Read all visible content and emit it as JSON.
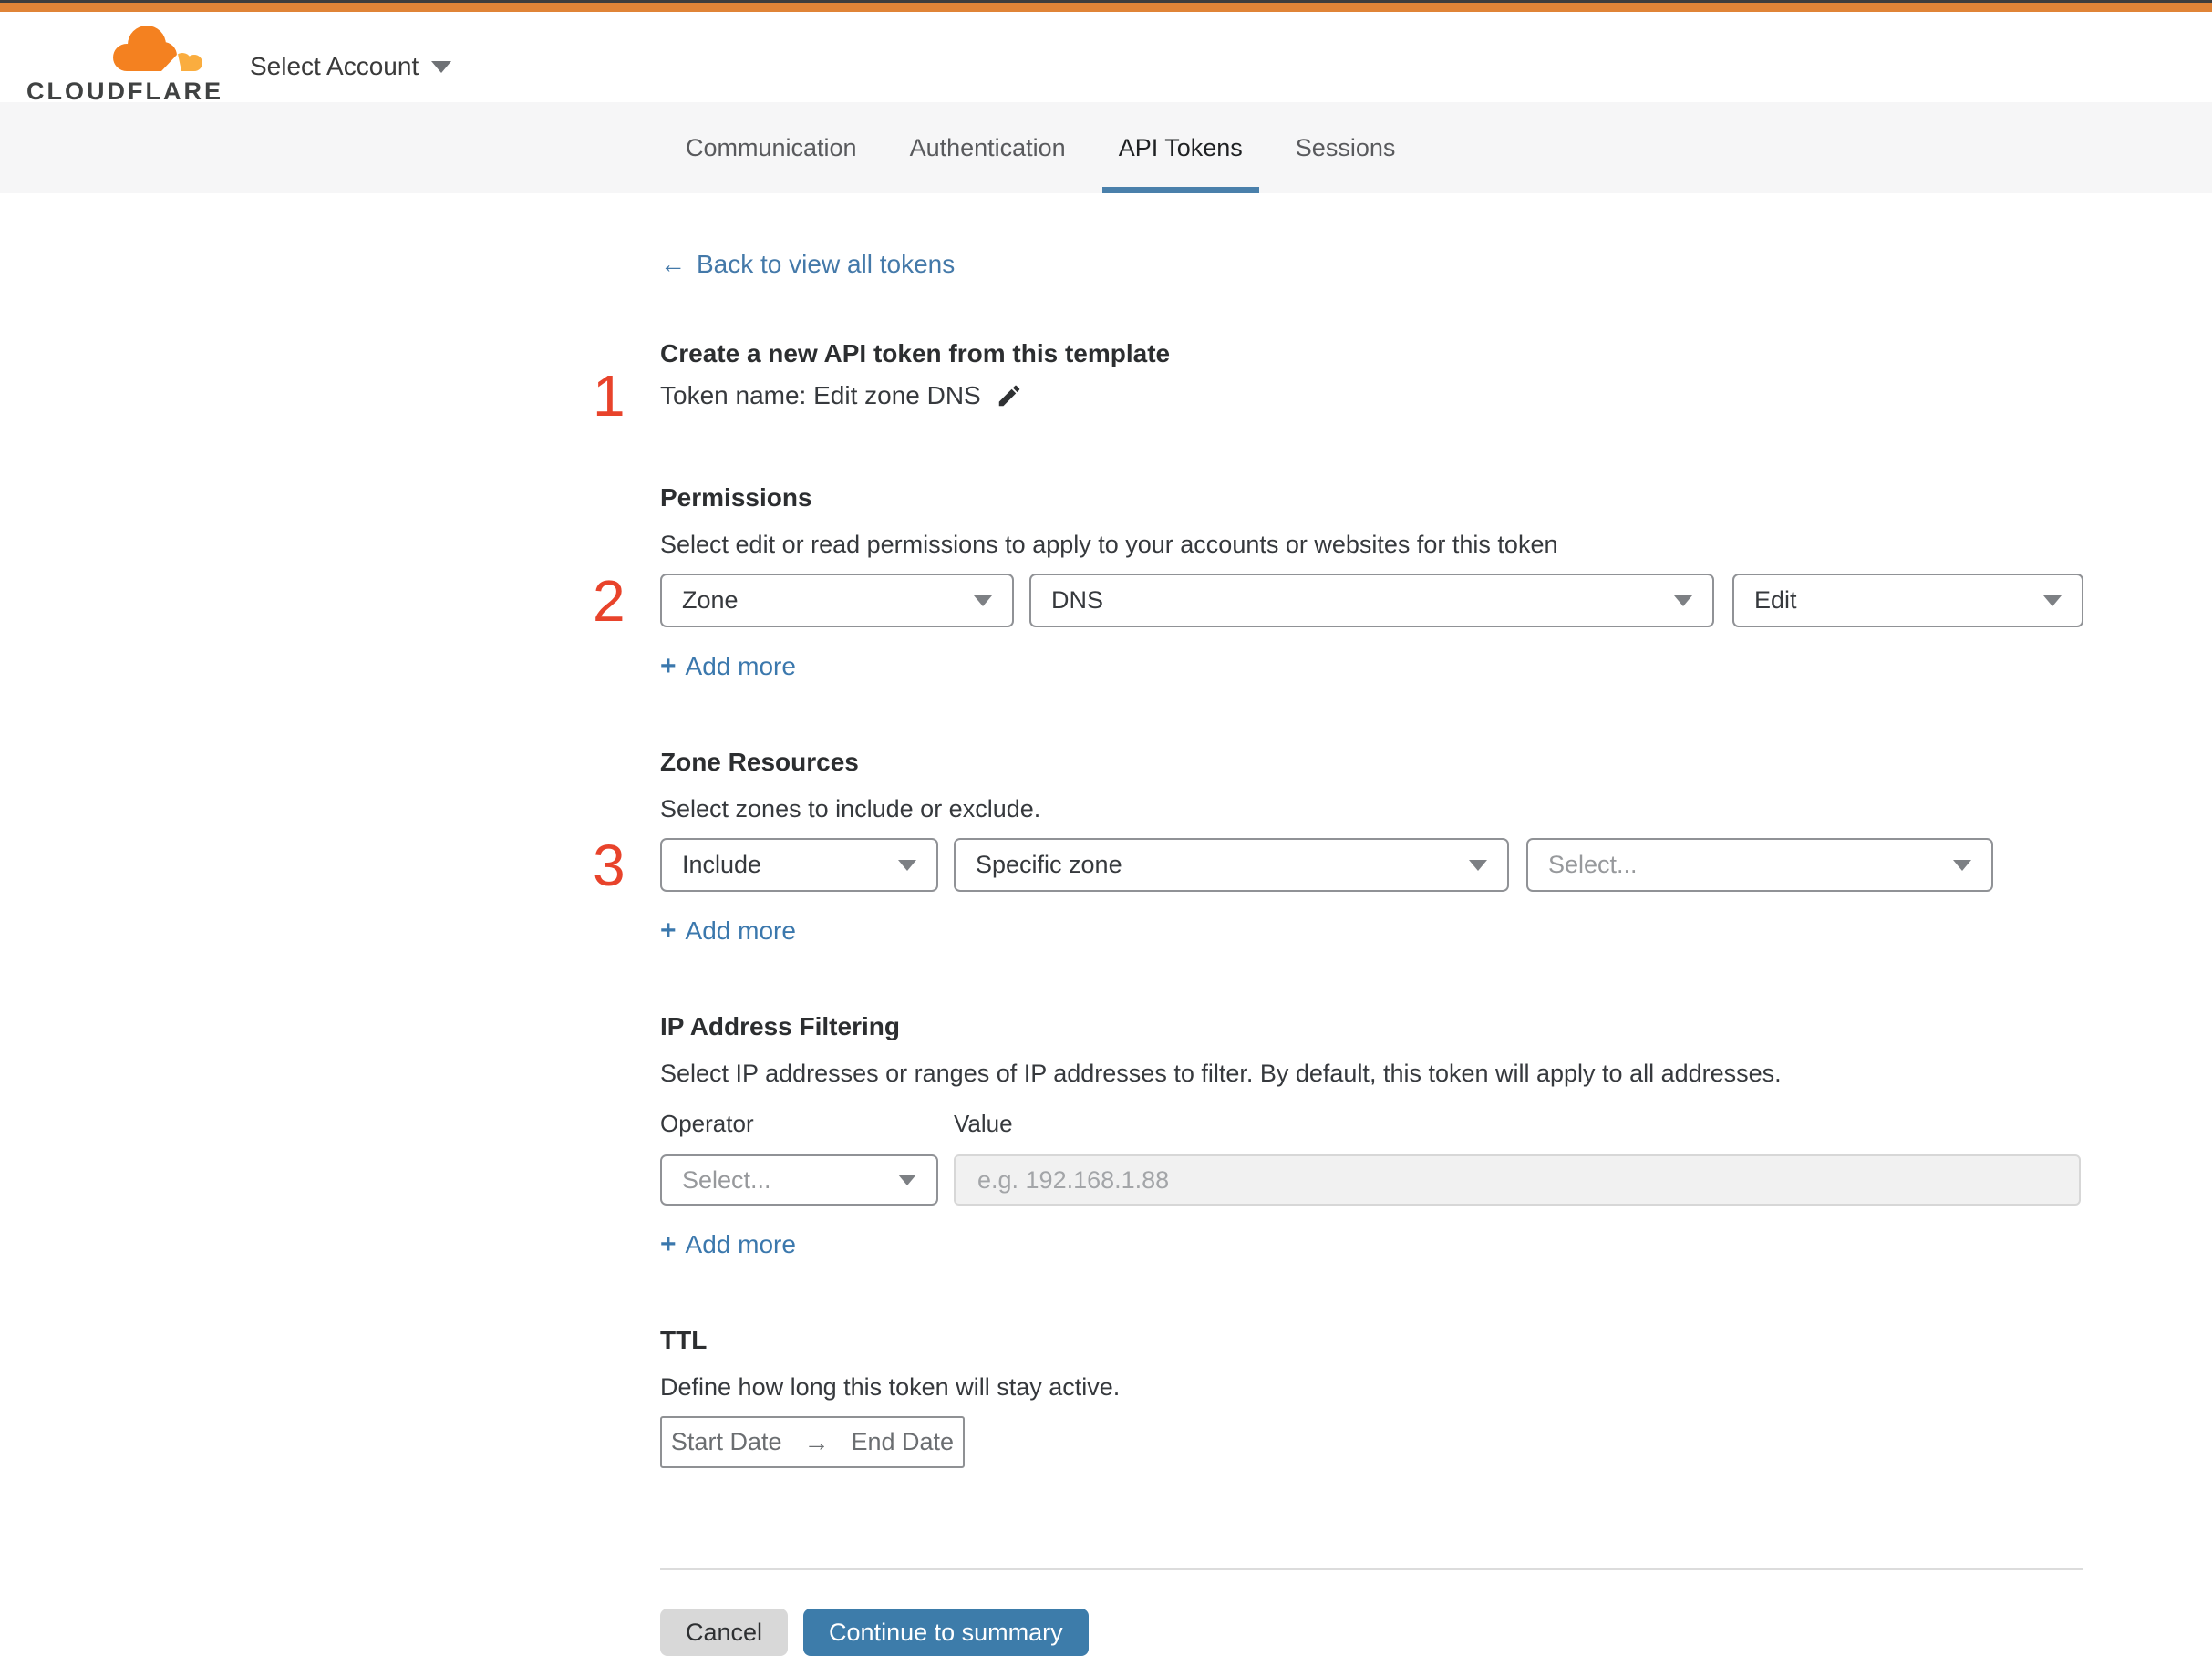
{
  "glyphs": {
    "plus": "+",
    "back_arrow": "←",
    "range_arrow": "→"
  },
  "colors": {
    "brand_orange": "#e08437",
    "logo_orange": "#f48120",
    "logo_light_orange": "#faad3f",
    "accent_blue": "#3d7caa",
    "link_blue": "#3b78ad",
    "tab_underline_blue": "#4a80ab",
    "step_red": "#e8432b"
  },
  "header": {
    "brand": "CLOUDFLARE",
    "account_selector_label": "Select Account"
  },
  "tabs": {
    "items": [
      {
        "label": "Communication",
        "active": false
      },
      {
        "label": "Authentication",
        "active": false
      },
      {
        "label": "API Tokens",
        "active": true
      },
      {
        "label": "Sessions",
        "active": false
      }
    ]
  },
  "main": {
    "back_link_label": "Back to view all tokens",
    "template_info": {
      "step": "1",
      "title": "Create a new API token from this template",
      "token_name": "Token name: Edit zone DNS"
    },
    "permissions": {
      "step": "2",
      "title": "Permissions",
      "description": "Select edit or read permissions to apply to your accounts or websites for this token",
      "scope_value": "Zone",
      "service_value": "DNS",
      "access_value": "Edit",
      "add_more_label": "Add more"
    },
    "zone_resources": {
      "step": "3",
      "title": "Zone Resources",
      "description": "Select zones to include or exclude.",
      "operator_value": "Include",
      "type_value": "Specific zone",
      "zone_placeholder": "Select...",
      "add_more_label": "Add more"
    },
    "ip_filtering": {
      "title": "IP Address Filtering",
      "description": "Select IP addresses or ranges of IP addresses to filter. By default, this token will apply to all addresses.",
      "operator_label": "Operator",
      "value_label": "Value",
      "operator_placeholder": "Select...",
      "value_placeholder": "e.g. 192.168.1.88",
      "add_more_label": "Add more"
    },
    "ttl": {
      "title": "TTL",
      "description": "Define how long this token will stay active.",
      "start_label": "Start Date",
      "end_label": "End Date"
    },
    "footer": {
      "cancel_label": "Cancel",
      "continue_label": "Continue to summary"
    }
  }
}
